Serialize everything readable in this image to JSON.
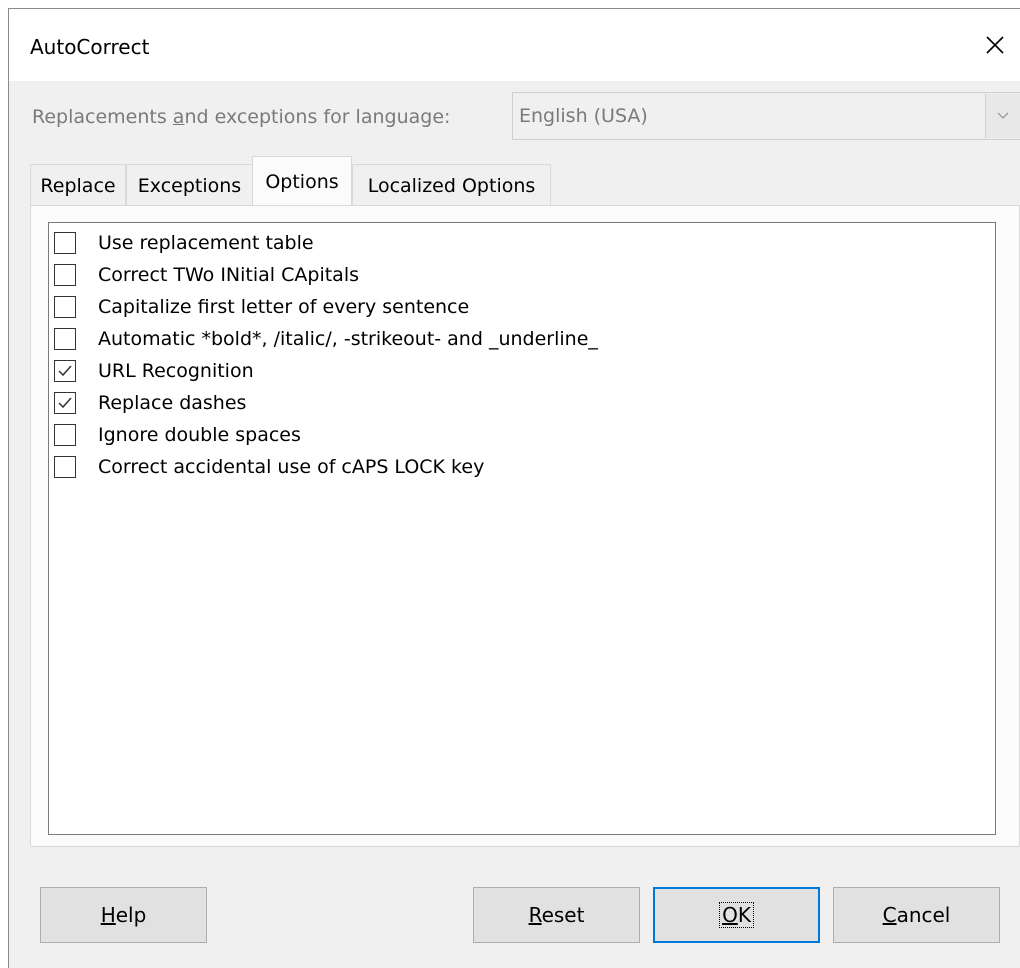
{
  "window": {
    "title": "AutoCorrect"
  },
  "language": {
    "label_pre": "Replacements ",
    "label_accel": "a",
    "label_post": "nd exceptions for language:",
    "value": "English (USA)"
  },
  "tabs": [
    {
      "label": "Replace"
    },
    {
      "label": "Exceptions"
    },
    {
      "label": "Options"
    },
    {
      "label": "Localized Options"
    }
  ],
  "options": [
    {
      "label": "Use replacement table",
      "checked": false
    },
    {
      "label": "Correct TWo INitial CApitals",
      "checked": false
    },
    {
      "label": "Capitalize first letter of every sentence",
      "checked": false
    },
    {
      "label": "Automatic *bold*, /italic/, -strikeout- and _underline_",
      "checked": false
    },
    {
      "label": "URL Recognition",
      "checked": true
    },
    {
      "label": "Replace dashes",
      "checked": true
    },
    {
      "label": "Ignore double spaces",
      "checked": false
    },
    {
      "label": "Correct accidental use of cAPS LOCK key",
      "checked": false
    }
  ],
  "buttons": {
    "help": {
      "accel": "H",
      "rest": "elp"
    },
    "reset": {
      "accel": "R",
      "rest": "eset"
    },
    "ok": {
      "accel": "O",
      "rest": "K"
    },
    "cancel": {
      "accel": "C",
      "rest": "ancel"
    }
  },
  "colors": {
    "accent": "#0078d7",
    "disabled_text": "#7a7a7a"
  }
}
